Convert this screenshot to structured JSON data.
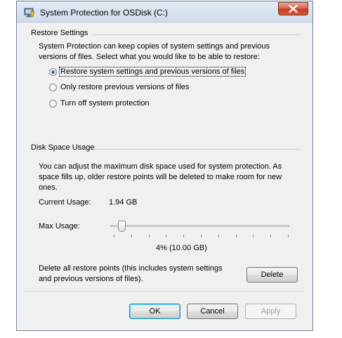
{
  "window": {
    "title": "System Protection for OSDisk (C:)",
    "icon": "system-protection-icon",
    "close_icon": "close-icon",
    "close_color": "#c7391f"
  },
  "restore_settings": {
    "heading": "Restore Settings",
    "description_line1": "System Protection can keep copies of system settings and previous",
    "description_line2": "versions of files. Select what you would like to be able to restore:",
    "options": [
      {
        "label": "Restore system settings and previous versions of files",
        "checked": true
      },
      {
        "label": "Only restore previous versions of files",
        "checked": false
      },
      {
        "label": "Turn off system protection",
        "checked": false
      }
    ]
  },
  "disk_space": {
    "heading": "Disk Space Usage",
    "description_line1": "You can adjust the maximum disk space used for system protection. As",
    "description_line2": "space fills up, older restore points will be deleted to make room for new",
    "description_line3": "ones.",
    "current_usage_label": "Current Usage:",
    "current_usage_value": "1.94 GB",
    "max_usage_label": "Max Usage:",
    "max_usage_percent": 4,
    "max_usage_readout": "4% (10.00 GB)",
    "delete_text_line1": "Delete all restore points (this includes system settings",
    "delete_text_line2": "and previous versions of files).",
    "delete_button": "Delete"
  },
  "buttons": {
    "ok": "OK",
    "cancel": "Cancel",
    "apply": "Apply"
  },
  "accent_color": "#3c7fb1"
}
